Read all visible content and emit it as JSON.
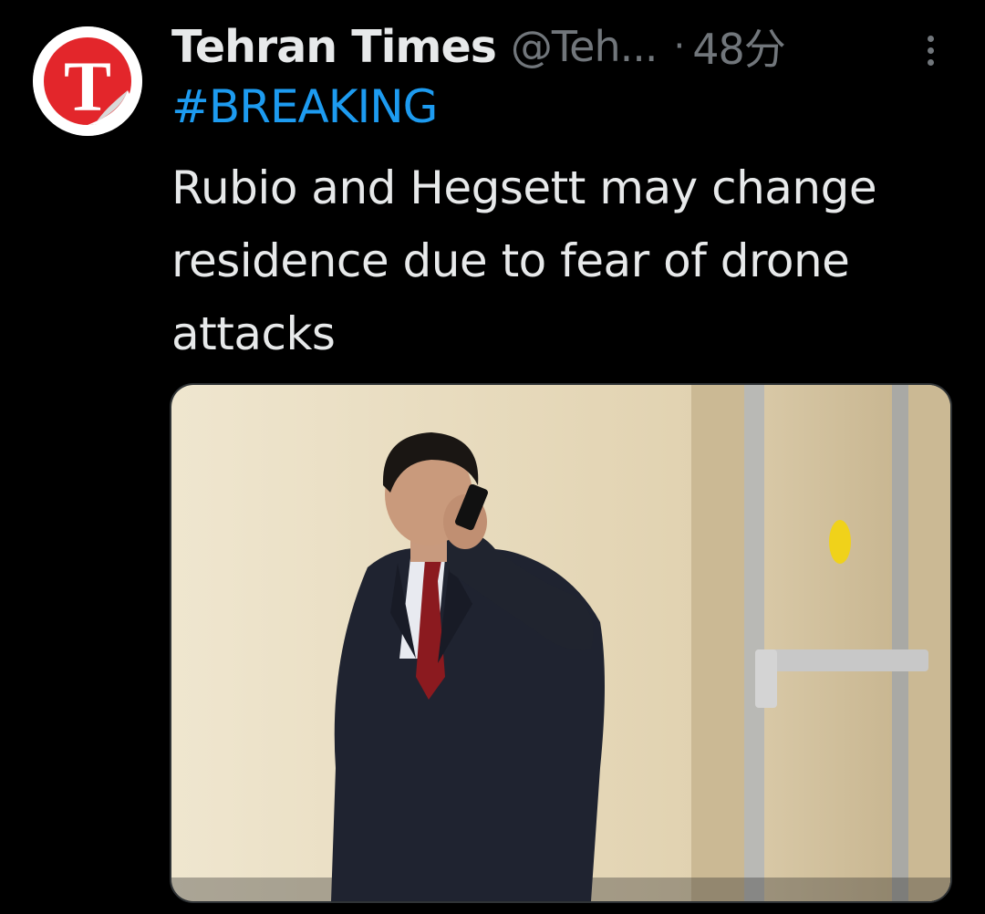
{
  "tweet": {
    "author_name": "Tehran Times",
    "author_handle": "@Teh...",
    "separator": "·",
    "time_ago": "48分",
    "hashtag": "#BREAKING",
    "text": "Rubio and Hegsett may change residence due to fear of drone attacks",
    "avatar_letter": "T"
  },
  "icons": {
    "more": "more-vertical-icon",
    "avatar": "tehran-times-logo"
  },
  "colors": {
    "background": "#000000",
    "primary_text": "#e7e9ea",
    "secondary_text": "#71767b",
    "link": "#1d9bf0",
    "logo_red": "#e3262b"
  }
}
